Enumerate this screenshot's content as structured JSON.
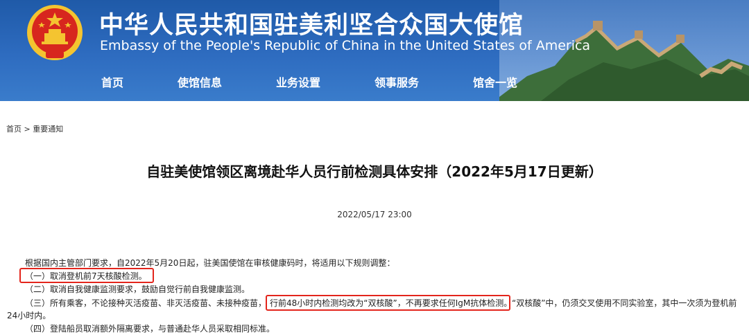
{
  "header": {
    "title_cn": "中华人民共和国驻美利坚合众国大使馆",
    "title_en": "Embassy of the People's Republic of China in the United States of America"
  },
  "nav": {
    "items": [
      {
        "label": "首页"
      },
      {
        "label": "使馆信息"
      },
      {
        "label": "业务设置"
      },
      {
        "label": "领事服务"
      },
      {
        "label": "馆舍一览"
      }
    ]
  },
  "breadcrumb": {
    "home": "首页",
    "separator": ">",
    "current": "重要通知"
  },
  "article": {
    "title": "自驻美使馆领区离境赴华人员行前检测具体安排（2022年5月17日更新）",
    "date": "2022/05/17 23:00",
    "intro": "根据国内主管部门要求，自2022年5月20日起，驻美国使馆在审核健康码时，将适用以下规则调整：",
    "item1": "（一）取消登机前7天核酸检测。",
    "item2": "（二）取消自我健康监测要求，鼓励自觉行前自我健康监测。",
    "item3_a": "（三）所有乘客，不论接种灭活疫苗、非灭活疫苗、未接种疫苗，",
    "item3_b": "行前48小时内检测均改为“双核酸”，不再要求任何IgM抗体检测。",
    "item3_c": "“双核酸”中，仍须交叉使用不同实验室，其中一次须为登机前",
    "item3_d": "24小时内。",
    "item4": "（四）登陆船员取消额外隔离要求，与普通赴华人员采取相同标准。"
  },
  "colors": {
    "header_blue": "#2e6cc0",
    "highlight_red": "#e3251c",
    "emblem_red": "#d7261e",
    "emblem_gold": "#f4c430"
  }
}
